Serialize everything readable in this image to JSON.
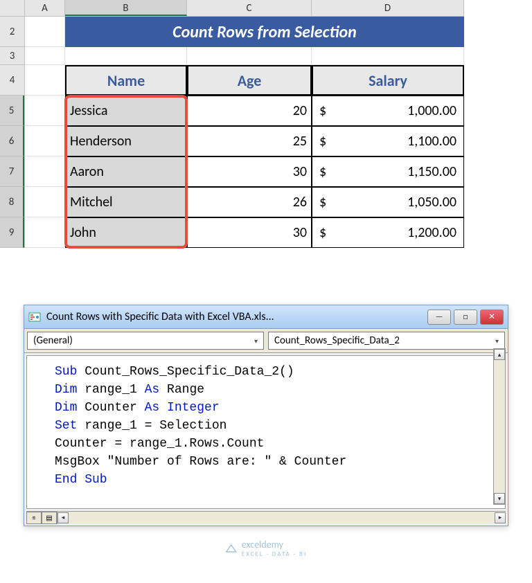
{
  "columns": [
    "A",
    "B",
    "C",
    "D"
  ],
  "rows": [
    "2",
    "3",
    "4",
    "5",
    "6",
    "7",
    "8",
    "9"
  ],
  "title": "Count Rows from Selection",
  "headers": {
    "name": "Name",
    "age": "Age",
    "salary": "Salary"
  },
  "records": [
    {
      "name": "Jessica",
      "age": "20",
      "sym": "$",
      "salary": "1,000.00"
    },
    {
      "name": "Henderson",
      "age": "25",
      "sym": "$",
      "salary": "1,100.00"
    },
    {
      "name": "Aaron",
      "age": "30",
      "sym": "$",
      "salary": "1,150.00"
    },
    {
      "name": "Mitchel",
      "age": "26",
      "sym": "$",
      "salary": "1,050.00"
    },
    {
      "name": "John",
      "age": "30",
      "sym": "$",
      "salary": "1,200.00"
    }
  ],
  "vbe": {
    "title": "Count Rows with Specific Data with Excel VBA.xls...",
    "dd_left": "(General)",
    "dd_right": "Count_Rows_Specific_Data_2",
    "code": {
      "l1a": "Sub",
      "l1b": " Count_Rows_Specific_Data_2()",
      "l2a": "Dim",
      "l2b": " range_1 ",
      "l2c": "As",
      "l2d": " Range",
      "l3a": "Dim",
      "l3b": " Counter ",
      "l3c": "As Integer",
      "l4a": "Set",
      "l4b": " range_1 = Selection",
      "l5": "Counter = range_1.Rows.Count",
      "l6": "MsgBox \"Number of Rows are: \" & Counter",
      "l7": "End Sub"
    }
  },
  "watermark": {
    "brand": "exceldemy",
    "tag": "EXCEL · DATA · BI"
  },
  "glyphs": {
    "min": "—",
    "max": "□",
    "close": "✕",
    "down": "▾",
    "up": "▴",
    "left": "◂",
    "right": "▸"
  }
}
